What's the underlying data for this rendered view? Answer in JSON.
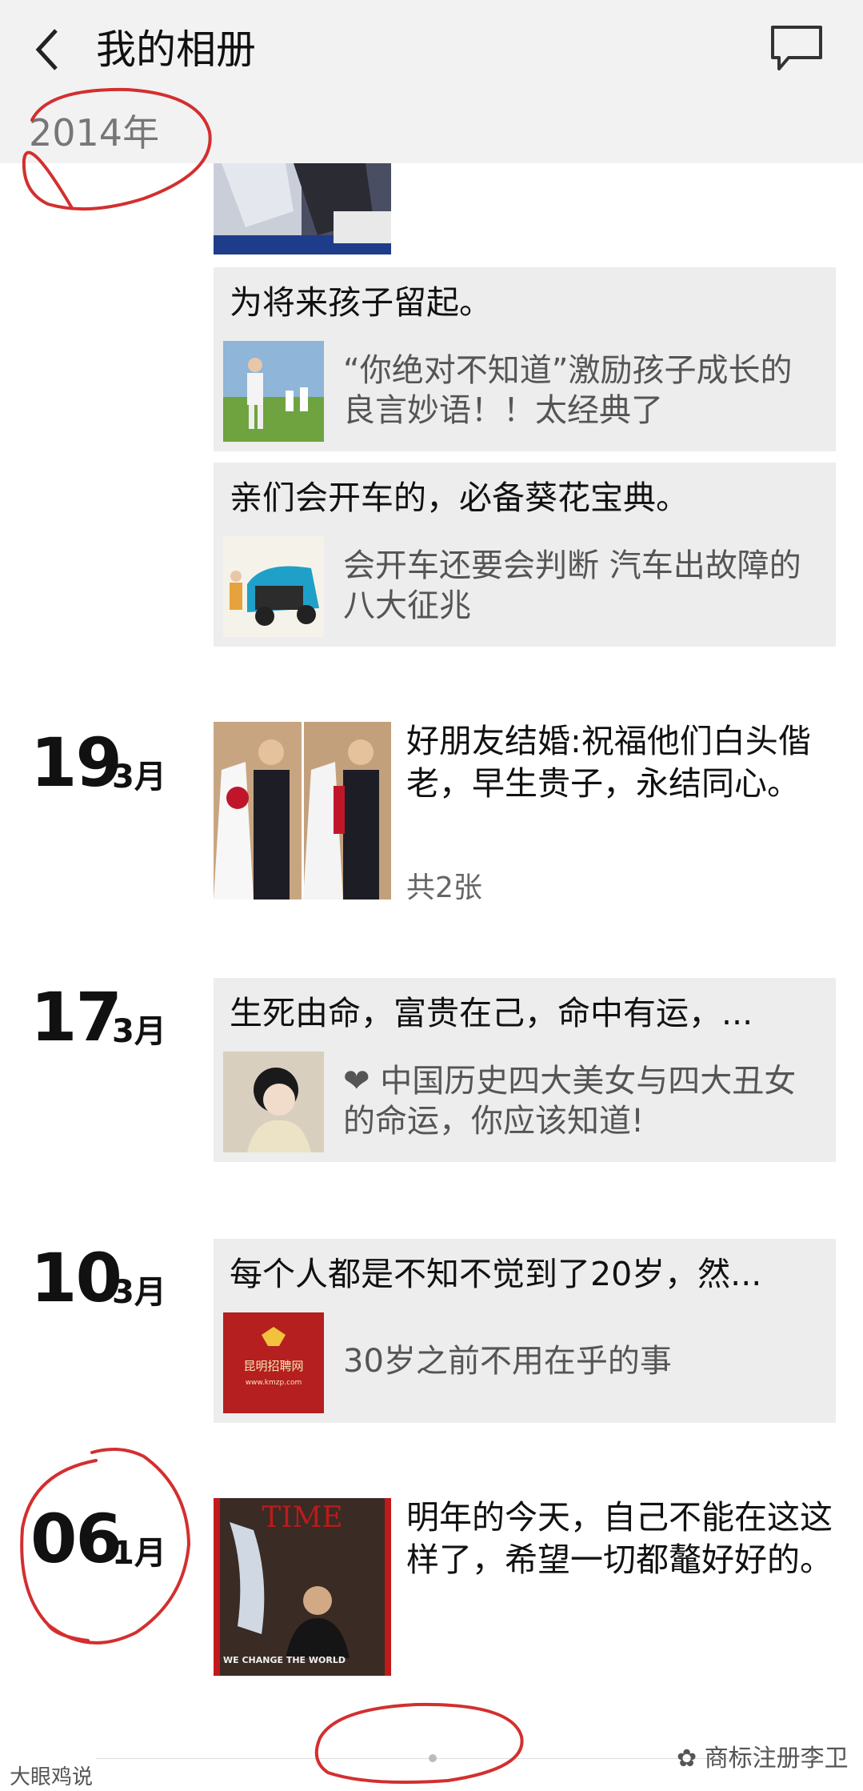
{
  "header": {
    "title": "我的相册"
  },
  "year_label": "2014年",
  "posts": [
    {
      "title": "为将来孩子留起。",
      "link_text": "“你绝对不知道”激励孩子成长的良言妙语！！太经典了"
    },
    {
      "title": "亲们会开车的，必备葵花宝典。",
      "link_text": "会开车还要会判断 汽车出故障的八大征兆"
    },
    {
      "day": "19",
      "month": "3月",
      "text": "好朋友结婚:祝福他们白头偕老，早生贵子，永结同心。",
      "count": "共2张"
    },
    {
      "day": "17",
      "month": "3月",
      "title": "生死由命，富贵在己，命中有运，...",
      "link_text": "❤ 中国历史四大美女与四大丑女的命运，你应该知道!"
    },
    {
      "day": "10",
      "month": "3月",
      "title": "每个人都是不知不觉到了20岁，然...",
      "link_text": "30岁之前不用在乎的事"
    },
    {
      "day": "06",
      "month": "1月",
      "text": "明年的今天，自己不能在这这样了，希望一切都鼇好好的。"
    }
  ],
  "thumbnails": {
    "kmzp_title": "昆明招聘网",
    "kmzp_url": "www.kmzp.com",
    "time_text": "TIME",
    "time_caption": "WE CHANGE THE WORLD"
  },
  "watermarks": {
    "left": "大眼鸡说",
    "right": "商标注册李卫"
  },
  "colors": {
    "annotation": "#d32f2f",
    "card_bg": "#ededed",
    "header_bg": "#f2f2f2"
  },
  "icons": {
    "back": "chevron-left-icon",
    "message": "message-icon"
  }
}
